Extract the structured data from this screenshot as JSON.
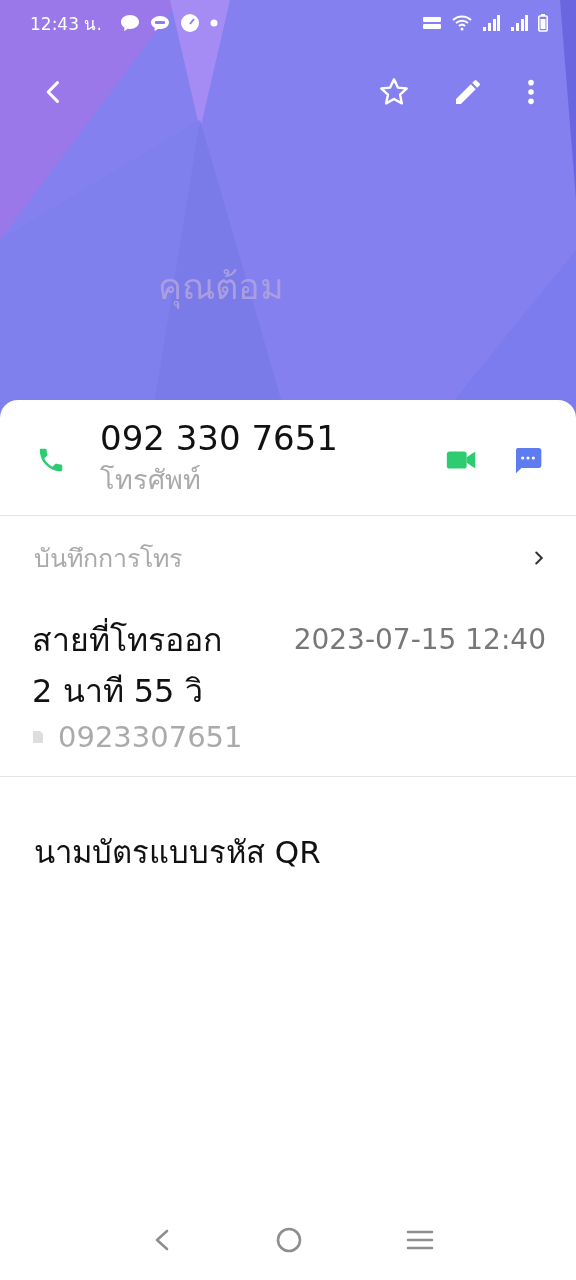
{
  "status_bar": {
    "time": "12:43 น."
  },
  "contact": {
    "name": "คุณต้อม",
    "starred": false
  },
  "phone": {
    "number": "092 330 7651",
    "label": "โทรศัพท์"
  },
  "call_log": {
    "title": "บันทึกการโทร",
    "entries": [
      {
        "type": "สายที่โทรออก",
        "date": "2023-07-15 12:40",
        "duration": "2 นาที 55 วิ",
        "number": "0923307651"
      }
    ]
  },
  "qr_card": {
    "label": "นามบัตรแบบรหัส QR"
  }
}
